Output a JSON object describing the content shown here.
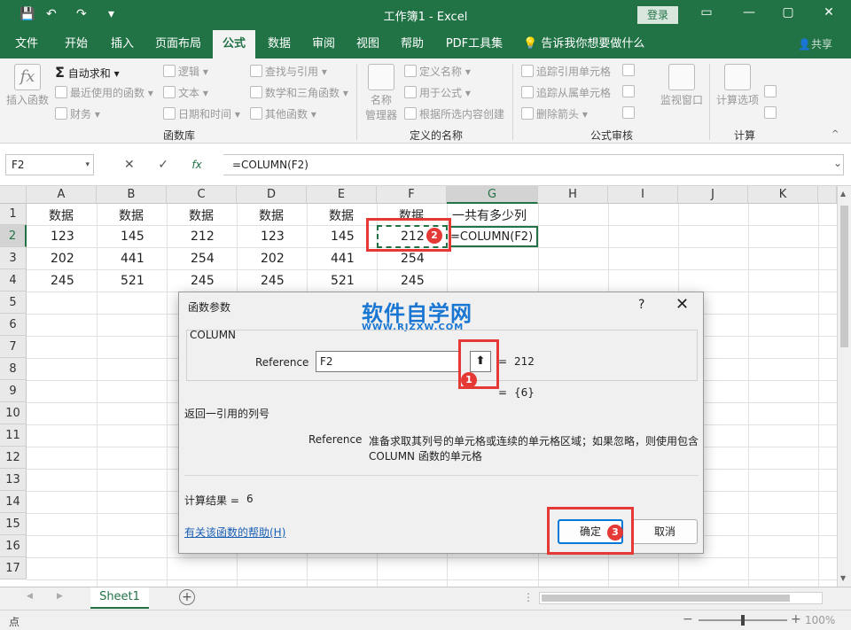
{
  "titlebar": {
    "title": "工作簿1  -  Excel",
    "login": "登录",
    "save_icon": "💾",
    "undo_icon": "↶",
    "redo_icon": "↷",
    "customize_icon": "▾",
    "ribbon_opts_icon": "▭",
    "minimize_icon": "—",
    "restore_icon": "▢",
    "close_icon": "✕"
  },
  "tabs": [
    "文件",
    "开始",
    "插入",
    "页面布局",
    "公式",
    "数据",
    "审阅",
    "视图",
    "帮助",
    "PDF工具集"
  ],
  "active_tab": "公式",
  "tell_me": "告诉我你想要做什么",
  "tell_me_icon": "💡",
  "share": "共享",
  "share_icon": "👤",
  "ribbon": {
    "insert_fn": "插入函数",
    "insert_fn_icon": "fx",
    "autosum": "自动求和",
    "autosum_icon": "Σ",
    "recent": "最近使用的函数",
    "finance": "财务",
    "logic": "逻辑",
    "text": "文本",
    "datetime": "日期和时间",
    "lookup": "查找与引用",
    "math": "数学和三角函数",
    "other": "其他函数",
    "group_library": "函数库",
    "name_mgr_line1": "名称",
    "name_mgr_line2": "管理器",
    "define_name": "定义名称",
    "use_in_formula": "用于公式",
    "create_from_sel": "根据所选内容创建",
    "group_names": "定义的名称",
    "trace_prec": "追踪引用单元格",
    "trace_dep": "追踪从属单元格",
    "remove_arrows": "删除箭头",
    "watch": "监视窗口",
    "group_audit": "公式审核",
    "calc_options": "计算选项",
    "group_calc": "计算",
    "dropdown_glyph": "▾",
    "collapse_glyph": "^"
  },
  "formula_bar": {
    "name_box": "F2",
    "formula": "=COLUMN(F2)",
    "cancel_icon": "✕",
    "enter_icon": "✓",
    "fx_icon": "fx",
    "expand_glyph": "⌄"
  },
  "columns": [
    "A",
    "B",
    "C",
    "D",
    "E",
    "F",
    "G",
    "H",
    "I",
    "J",
    "K"
  ],
  "rows": [
    "1",
    "2",
    "3",
    "4",
    "5",
    "6",
    "7",
    "8",
    "9",
    "10",
    "11",
    "12",
    "13",
    "14",
    "15",
    "16",
    "17"
  ],
  "cells": {
    "r1": [
      "数据",
      "数据",
      "数据",
      "数据",
      "数据",
      "数据",
      "一共有多少列"
    ],
    "r2": [
      "123",
      "145",
      "212",
      "123",
      "145",
      "212",
      "=COLUMN(F2)"
    ],
    "r3": [
      "202",
      "441",
      "254",
      "202",
      "441",
      "254"
    ],
    "r4": [
      "245",
      "521",
      "245",
      "245",
      "521",
      "245"
    ]
  },
  "sheet": {
    "tab": "Sheet1",
    "add_icon": "+",
    "prev_icon": "◀",
    "next_icon": "▶"
  },
  "status": {
    "mode": "点",
    "zoom": "100%",
    "zoom_minus": "−",
    "zoom_plus": "+"
  },
  "dialog": {
    "title": "函数参数",
    "help_q": "?",
    "close": "✕",
    "fn_name": "COLUMN",
    "ref_label": "Reference",
    "ref_value": "F2",
    "ref_btn_icon": "⬆",
    "ref_eq": "=",
    "ref_result": "212",
    "result_eq": "=",
    "array_result": "{6}",
    "desc": "返回一引用的列号",
    "param_name": "Reference",
    "param_desc_1": "准备求取其列号的单元格或连续的单元格区域；如果忽略，则使用包含",
    "param_desc_2": "COLUMN 函数的单元格",
    "calc_result_label": "计算结果 =",
    "calc_result": "6",
    "help_link": "有关该函数的帮助(H)",
    "ok": "确定",
    "cancel": "取消"
  },
  "watermark": {
    "main": "软件自学网",
    "sub": "WWW.RJZXW.COM"
  },
  "badges": [
    "1",
    "2",
    "3"
  ]
}
